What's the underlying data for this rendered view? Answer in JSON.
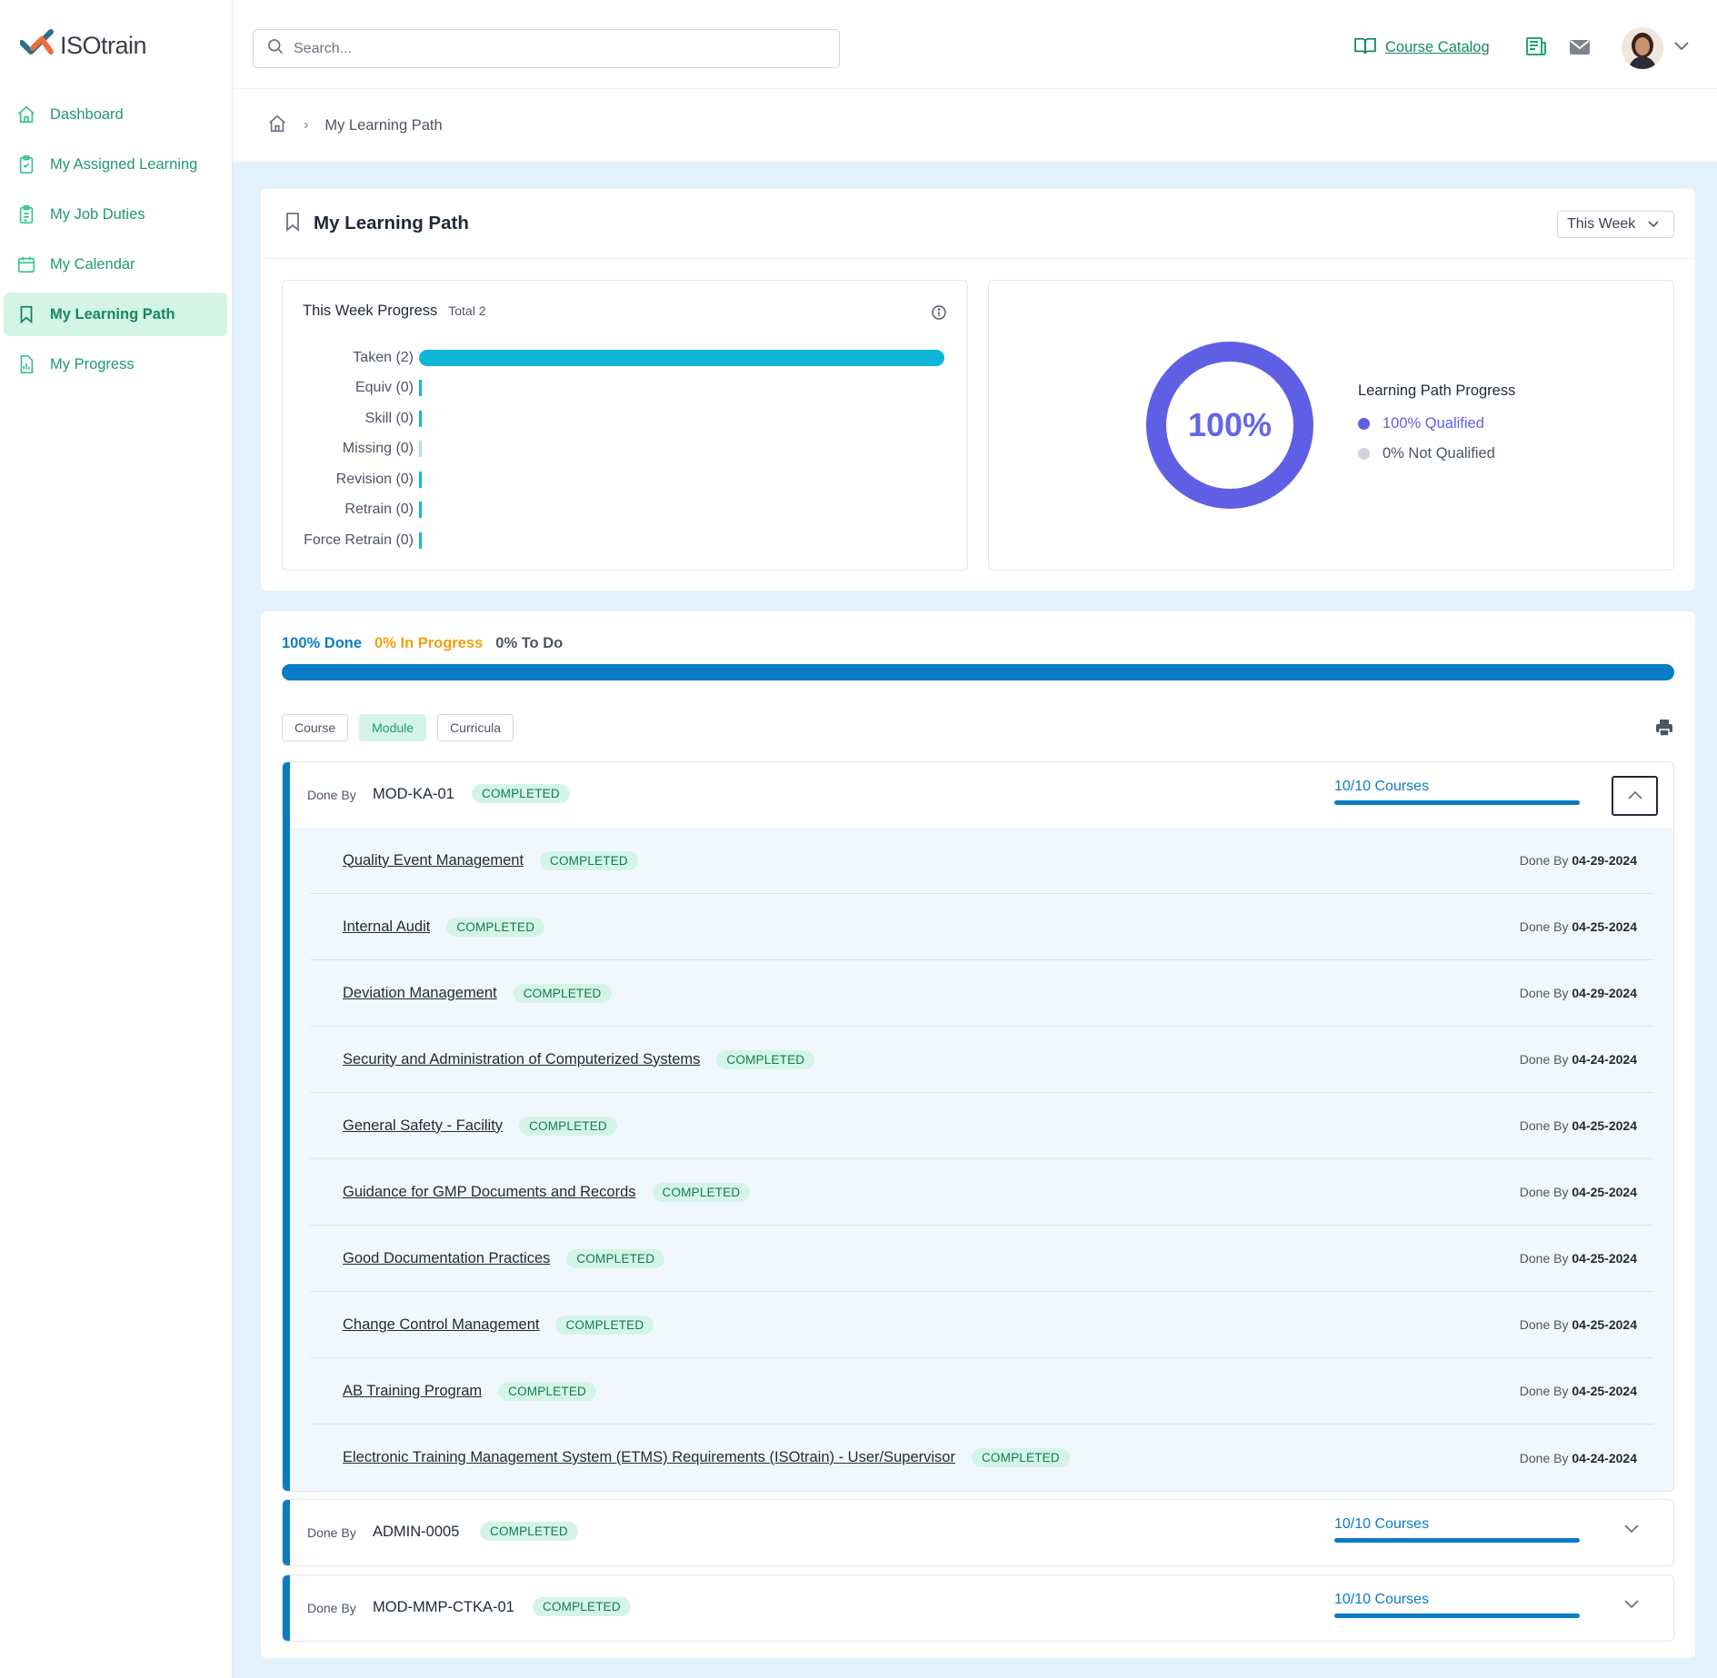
{
  "app": {
    "logo_text": "ISOtrain"
  },
  "sidebar": {
    "items": [
      {
        "label": "Dashboard",
        "icon": "home-icon"
      },
      {
        "label": "My Assigned Learning",
        "icon": "clipboard-check-icon"
      },
      {
        "label": "My Job Duties",
        "icon": "clipboard-list-icon"
      },
      {
        "label": "My Calendar",
        "icon": "calendar-icon"
      },
      {
        "label": "My Learning Path",
        "icon": "bookmark-icon",
        "active": true
      },
      {
        "label": "My Progress",
        "icon": "report-icon"
      }
    ]
  },
  "topbar": {
    "search_placeholder": "Search...",
    "catalog_label": "Course Catalog",
    "icons": [
      "book-open-icon",
      "news-icon",
      "mail-icon",
      "avatar",
      "chevron-down-icon"
    ]
  },
  "breadcrumb": {
    "current": "My Learning Path"
  },
  "learning_path": {
    "title": "My Learning Path",
    "period_select": "This Week",
    "week_progress": {
      "title": "This Week Progress",
      "total_label": "Total 2",
      "bars": [
        {
          "label": "Taken (2)",
          "value": 2
        },
        {
          "label": "Equiv (0)",
          "value": 0
        },
        {
          "label": "Skill (0)",
          "value": 0
        },
        {
          "label": "Missing (0)",
          "value": 0
        },
        {
          "label": "Revision (0)",
          "value": 0
        },
        {
          "label": "Retrain (0)",
          "value": 0
        },
        {
          "label": "Force Retrain (0)",
          "value": 0
        }
      ],
      "max": 2
    },
    "path_progress": {
      "center_label": "100%",
      "qualified_fraction": 1.0,
      "legend_title": "Learning Path Progress",
      "legend": [
        {
          "label": "100% Qualified",
          "color": "#5f5fe6"
        },
        {
          "label": "0% Not Qualified",
          "color": "#d1d5db"
        }
      ]
    }
  },
  "overall": {
    "done_label": "100% Done",
    "in_progress_label": "0% In Progress",
    "todo_label": "0% To Do",
    "done_fraction": 1.0,
    "colors": {
      "done": "#0a7cc4",
      "in_progress": "#f59e0b",
      "todo": "#4b5563"
    }
  },
  "filters": [
    {
      "label": "Course",
      "active": false
    },
    {
      "label": "Module",
      "active": true
    },
    {
      "label": "Curricula",
      "active": false
    }
  ],
  "modules": [
    {
      "done_by_label": "Done By",
      "code": "MOD-KA-01",
      "status": "COMPLETED",
      "count_label": "10/10 Courses",
      "count_fraction": 1.0,
      "expanded": true,
      "courses": [
        {
          "name": "Quality Event Management",
          "status": "COMPLETED",
          "done_by_label": "Done By",
          "date": "04-29-2024"
        },
        {
          "name": "Internal Audit",
          "status": "COMPLETED",
          "done_by_label": "Done By",
          "date": "04-25-2024"
        },
        {
          "name": "Deviation Management",
          "status": "COMPLETED",
          "done_by_label": "Done By",
          "date": "04-29-2024"
        },
        {
          "name": "Security and Administration of Computerized Systems",
          "status": "COMPLETED",
          "done_by_label": "Done By",
          "date": "04-24-2024"
        },
        {
          "name": "General Safety - Facility",
          "status": "COMPLETED",
          "done_by_label": "Done By",
          "date": "04-25-2024"
        },
        {
          "name": "Guidance for GMP Documents and Records",
          "status": "COMPLETED",
          "done_by_label": "Done By",
          "date": "04-25-2024"
        },
        {
          "name": "Good Documentation Practices",
          "status": "COMPLETED",
          "done_by_label": "Done By",
          "date": "04-25-2024"
        },
        {
          "name": "Change Control Management",
          "status": "COMPLETED",
          "done_by_label": "Done By",
          "date": "04-25-2024"
        },
        {
          "name": "AB Training Program",
          "status": "COMPLETED",
          "done_by_label": "Done By",
          "date": "04-25-2024"
        },
        {
          "name": "Electronic Training Management System (ETMS) Requirements (ISOtrain) - User/Supervisor",
          "status": "COMPLETED",
          "done_by_label": "Done By",
          "date": "04-24-2024"
        }
      ]
    },
    {
      "done_by_label": "Done By",
      "code": "ADMIN-0005",
      "status": "COMPLETED",
      "count_label": "10/10 Courses",
      "count_fraction": 1.0,
      "expanded": false
    },
    {
      "done_by_label": "Done By",
      "code": "MOD-MMP-CTKA-01",
      "status": "COMPLETED",
      "count_label": "10/10 Courses",
      "count_fraction": 1.0,
      "expanded": false
    }
  ]
}
